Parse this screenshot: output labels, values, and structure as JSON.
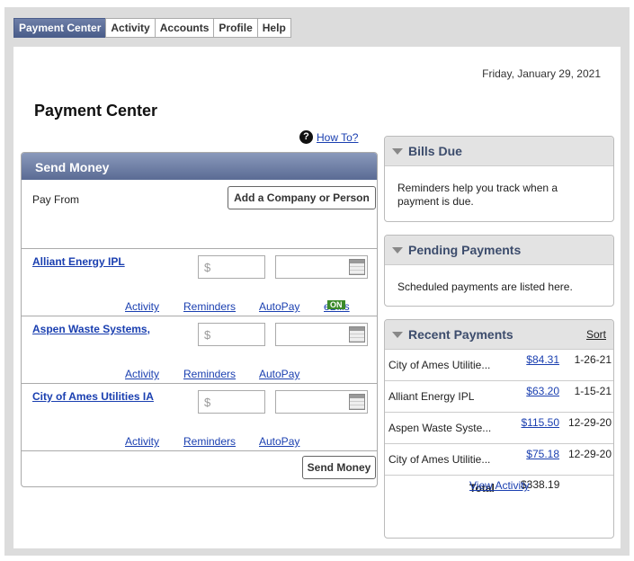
{
  "tabs": [
    "Payment Center",
    "Activity",
    "Accounts",
    "Profile",
    "Help"
  ],
  "date": "Friday, January 29, 2021",
  "page_title": "Payment Center",
  "how_to": "How To?",
  "send_money": {
    "header": "Send Money",
    "pay_from": "Pay From",
    "add_button": "Add a Company or Person",
    "amount_placeholder": "$",
    "payees": [
      {
        "name": "Alliant Energy IPL",
        "links": [
          "Activity",
          "Reminders",
          "AutoPay",
          "eBills"
        ],
        "badge": "ON"
      },
      {
        "name": "Aspen Waste Systems,",
        "links": [
          "Activity",
          "Reminders",
          "AutoPay"
        ]
      },
      {
        "name": "City of Ames Utilities IA",
        "links": [
          "Activity",
          "Reminders",
          "AutoPay"
        ]
      }
    ],
    "send_button": "Send Money"
  },
  "bills_due": {
    "title": "Bills Due",
    "text": "Reminders help you track when a payment is due."
  },
  "pending": {
    "title": "Pending Payments",
    "text": "Scheduled payments are listed here."
  },
  "recent": {
    "title": "Recent Payments",
    "sort": "Sort",
    "rows": [
      {
        "name": "City of Ames Utilitie...",
        "amount": "$84.31",
        "date": "1-26-21"
      },
      {
        "name": "Alliant Energy IPL",
        "amount": "$63.20",
        "date": "1-15-21"
      },
      {
        "name": "Aspen Waste Syste...",
        "amount": "$115.50",
        "date": "12-29-20"
      },
      {
        "name": "City of Ames Utilitie...",
        "amount": "$75.18",
        "date": "12-29-20"
      }
    ],
    "total_label": "Total",
    "total_value": "$338.19",
    "view_activity": "View Activity"
  }
}
